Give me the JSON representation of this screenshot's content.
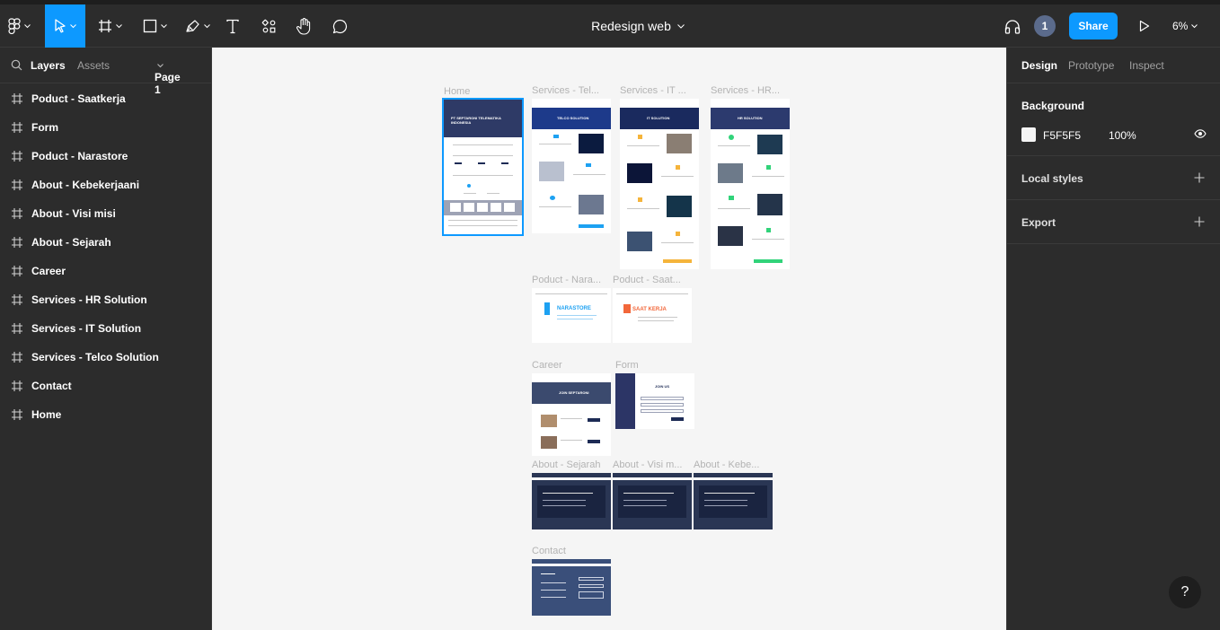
{
  "toolbar": {
    "main_menu_icon": "figma-logo-icon",
    "tools": [
      "move-tool",
      "frame-tool",
      "shape-tool",
      "pen-tool",
      "text-tool",
      "resources-tool",
      "hand-tool",
      "comment-tool"
    ],
    "document_title": "Redesign web",
    "collaborator_count": "1",
    "share_label": "Share",
    "zoom_label": "6%"
  },
  "left_panel": {
    "tabs": {
      "layers": "Layers",
      "assets": "Assets",
      "page": "Page 1"
    },
    "layers": [
      "Poduct - Saatkerja",
      "Form",
      "Poduct - Narastore",
      "About - Kebekerjaani",
      "About - Visi misi",
      "About - Sejarah",
      "Career",
      "Services - HR Solution",
      "Services - IT Solution",
      "Services - Telco Solution",
      "Contact",
      "Home"
    ]
  },
  "canvas": {
    "background": "#f5f5f5",
    "frames": {
      "home": "Home",
      "telco": "Services - Tel...",
      "it": "Services - IT ...",
      "hr": "Services - HR...",
      "narastore": "Poduct - Nara...",
      "saatkerja": "Poduct - Saat...",
      "career": "Career",
      "form": "Form",
      "sejarah": "About - Sejarah",
      "visimisi": "About - Visi m...",
      "kebe": "About - Kebe...",
      "contact": "Contact"
    },
    "thumb_text": {
      "home_hero": "PT SEPTARONI TELEMATIKA INDONESIA",
      "telco_banner": "TELCO SOLUTION",
      "it_banner": "IT SOLUTION",
      "hr_banner": "HR SOLUTION",
      "narastore_logo": "NARASTORE",
      "saatkerja_logo": "SAAT KERJA",
      "career_banner": "JOIN SEPTARONI",
      "form_title": "JOIN US"
    }
  },
  "right_panel": {
    "tabs": {
      "design": "Design",
      "prototype": "Prototype",
      "inspect": "Inspect"
    },
    "background": {
      "title": "Background",
      "hex": "F5F5F5",
      "opacity": "100%",
      "swatch_color": "#f5f5f5"
    },
    "local_styles": "Local styles",
    "export": "Export"
  },
  "help_label": "?"
}
